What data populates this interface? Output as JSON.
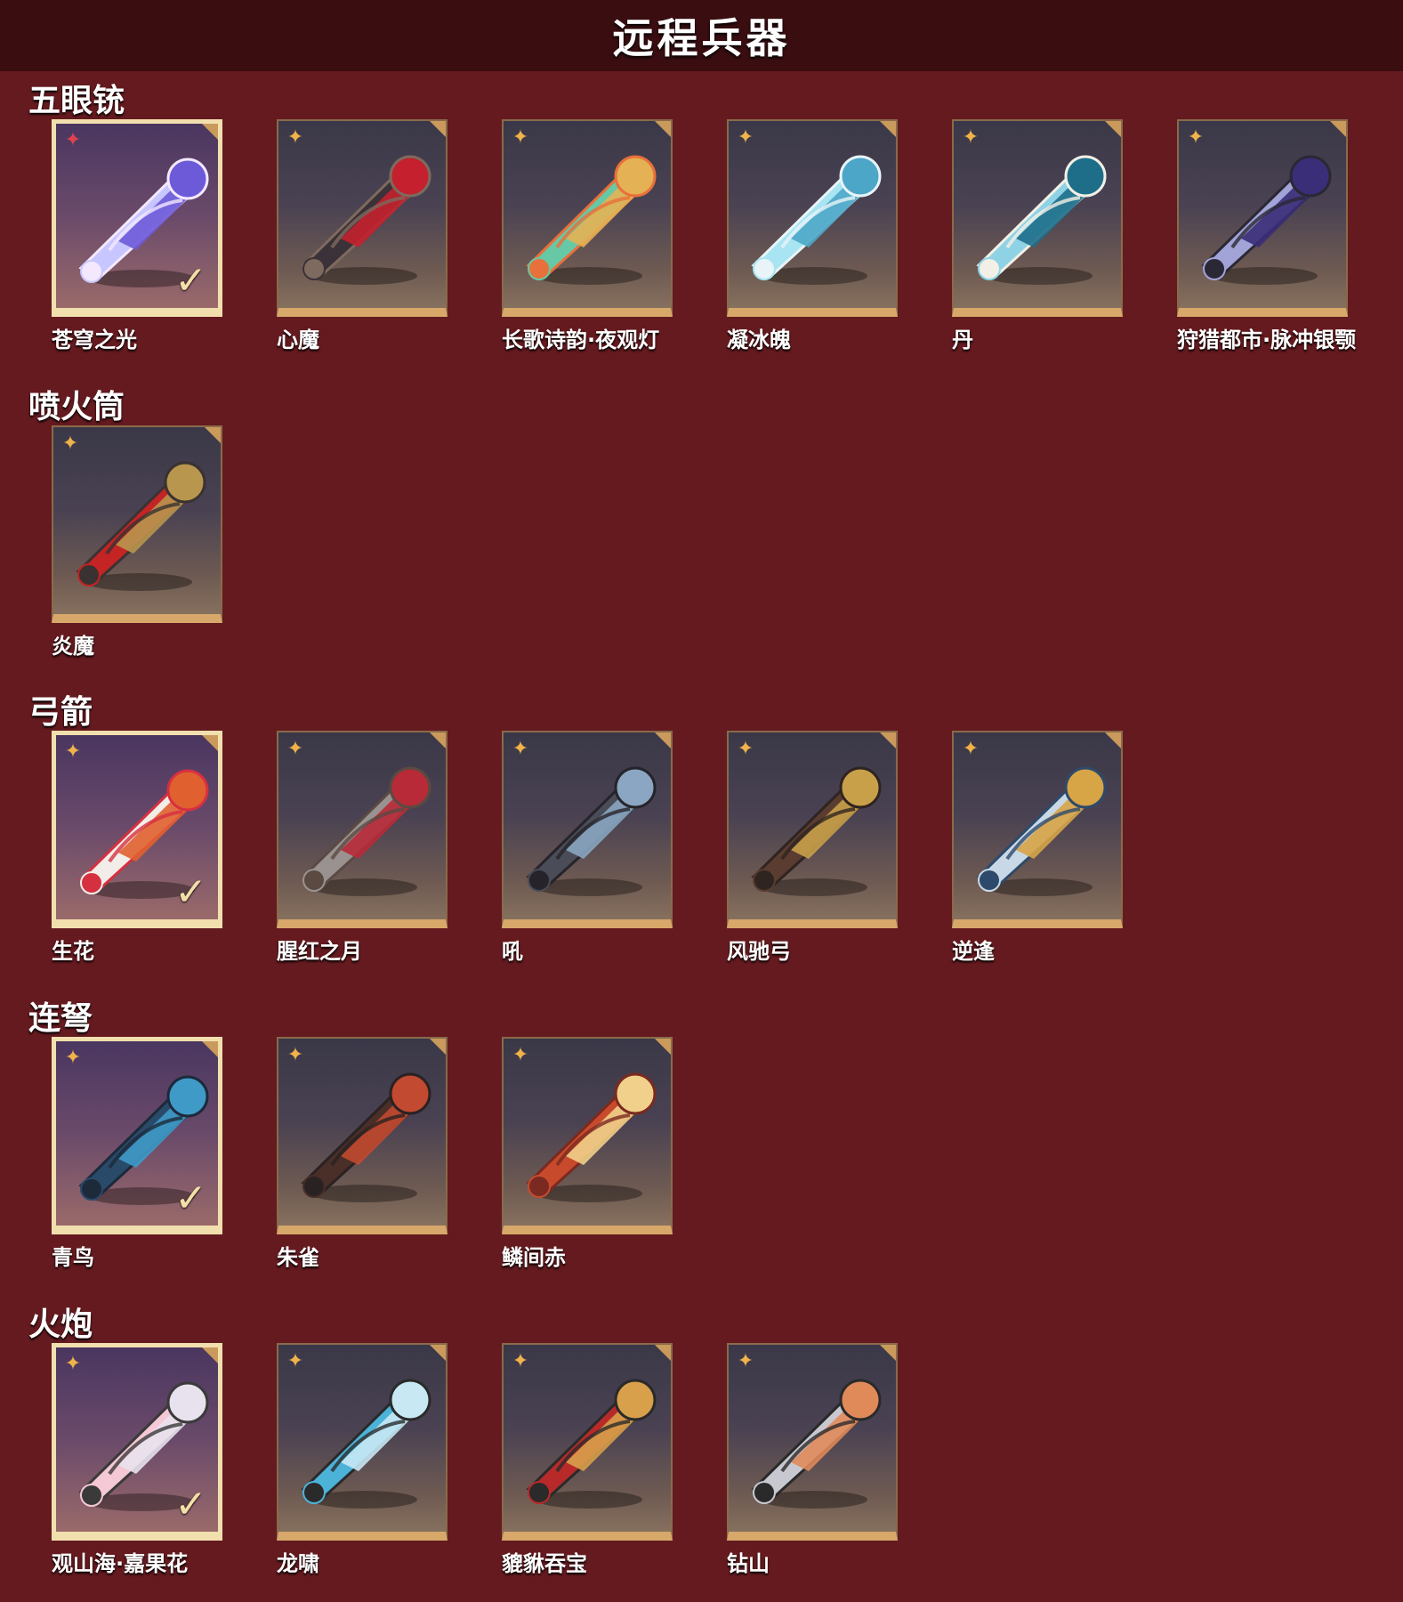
{
  "page_title": "远程兵器",
  "colors": {
    "background": "#641a1f",
    "title_bar": "#3a0e11",
    "card_accent": "#d7a86a",
    "selected_border": "#f2dfae",
    "rank_gold": "#f0b34a",
    "rank_red": "#e0414e"
  },
  "sections": [
    {
      "title": "五眼铳",
      "items": [
        {
          "name": "苍穹之光",
          "rank_icon": "red-star-icon",
          "equipped": true,
          "palette": [
            "#c8c6ff",
            "#6d5ad8",
            "#f4e8ff"
          ]
        },
        {
          "name": "心魔",
          "rank_icon": "gold-star-icon",
          "equipped": false,
          "palette": [
            "#3a3238",
            "#c4202e",
            "#7e6a5e"
          ]
        },
        {
          "name": "长歌诗韵·夜观灯",
          "rank_icon": "gold-star-icon",
          "equipped": false,
          "palette": [
            "#67c8a6",
            "#e4b155",
            "#e8703a"
          ]
        },
        {
          "name": "凝冰魄",
          "rank_icon": "gold-star-icon",
          "equipped": false,
          "palette": [
            "#a8e4f2",
            "#4ca6c8",
            "#e8f4f8"
          ]
        },
        {
          "name": "丹",
          "rank_icon": "gold-star-icon",
          "equipped": false,
          "palette": [
            "#8fd2e6",
            "#1e6e8a",
            "#f2f0e6"
          ]
        },
        {
          "name": "狩猎都市·脉冲银颚",
          "rank_icon": "gold-star-icon",
          "equipped": false,
          "palette": [
            "#a2a4d8",
            "#3a2e78",
            "#2a2834"
          ]
        }
      ]
    },
    {
      "title": "喷火筒",
      "items": [
        {
          "name": "炎魔",
          "rank_icon": "gold-star-icon",
          "equipped": false,
          "palette": [
            "#c42424",
            "#b8964e",
            "#3a3232"
          ]
        }
      ]
    },
    {
      "title": "弓箭",
      "items": [
        {
          "name": "生花",
          "rank_icon": "gold-star-icon",
          "equipped": true,
          "palette": [
            "#f2ede8",
            "#e06030",
            "#d63040"
          ]
        },
        {
          "name": "腥红之月",
          "rank_icon": "gold-star-icon",
          "equipped": false,
          "palette": [
            "#9a9290",
            "#b82a38",
            "#5a4a42"
          ]
        },
        {
          "name": "吼",
          "rank_icon": "gold-star-icon",
          "equipped": false,
          "palette": [
            "#4a4c58",
            "#8aa6c2",
            "#26242a"
          ]
        },
        {
          "name": "风驰弓",
          "rank_icon": "gold-star-icon",
          "equipped": false,
          "palette": [
            "#5a3c30",
            "#c9a04a",
            "#2e2420"
          ]
        },
        {
          "name": "逆逢",
          "rank_icon": "gold-star-icon",
          "equipped": false,
          "palette": [
            "#c8d8e6",
            "#d7a446",
            "#2e4a6a"
          ]
        }
      ]
    },
    {
      "title": "连弩",
      "items": [
        {
          "name": "青鸟",
          "rank_icon": "gold-star-icon",
          "equipped": true,
          "palette": [
            "#2a4a6a",
            "#3f9ac8",
            "#1c2a3a"
          ]
        },
        {
          "name": "朱雀",
          "rank_icon": "gold-star-icon",
          "equipped": false,
          "palette": [
            "#4a2e28",
            "#c24a30",
            "#2a2222"
          ]
        },
        {
          "name": "鳞间赤",
          "rank_icon": "gold-star-icon",
          "equipped": false,
          "palette": [
            "#c84a2c",
            "#f0d08a",
            "#7a2a20"
          ]
        }
      ]
    },
    {
      "title": "火炮",
      "items": [
        {
          "name": "观山海·嘉果花",
          "rank_icon": "gold-star-icon",
          "equipped": true,
          "palette": [
            "#f4c8d4",
            "#e8e2ee",
            "#3a3a3a"
          ]
        },
        {
          "name": "龙啸",
          "rank_icon": "gold-star-icon",
          "equipped": false,
          "palette": [
            "#4cb2d8",
            "#c8e8f4",
            "#2a2a2a"
          ]
        },
        {
          "name": "貔貅吞宝",
          "rank_icon": "gold-star-icon",
          "equipped": false,
          "palette": [
            "#b82a2a",
            "#d8a04a",
            "#2a2a2a"
          ]
        },
        {
          "name": "钻山",
          "rank_icon": "gold-star-icon",
          "equipped": false,
          "palette": [
            "#c8c8d0",
            "#e08a5a",
            "#2a2a2a"
          ]
        }
      ]
    }
  ]
}
